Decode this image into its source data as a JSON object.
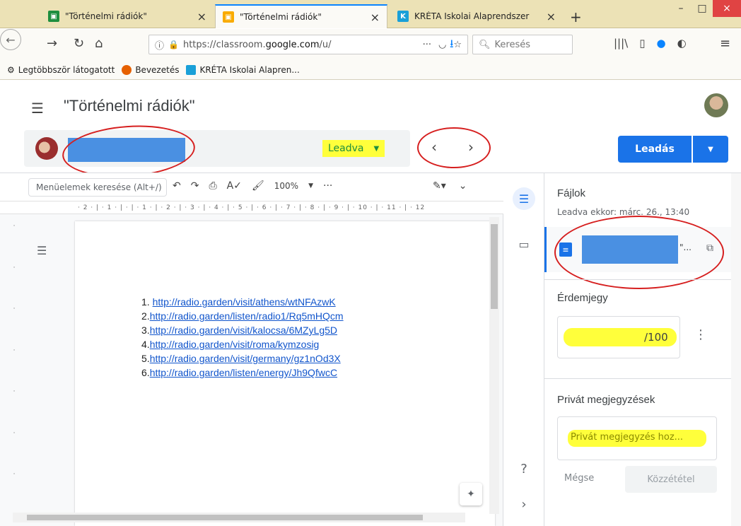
{
  "browser": {
    "tabs": [
      {
        "title": "\"Történelmi rádiók\"",
        "close": "×"
      },
      {
        "title": "\"Történelmi rádiók\"",
        "close": "×"
      },
      {
        "title": "KRÉTA Iskolai Alaprendszer",
        "close": "×"
      }
    ],
    "new_tab": "+",
    "window": {
      "minimize": "–",
      "maximize": "□",
      "close": "×"
    },
    "url_prefix": "https://classroom.",
    "url_domain": "google.com",
    "url_suffix": "/u/",
    "search_placeholder": "Keresés",
    "bookmarks": [
      {
        "label": "Legtöbbször látogatott"
      },
      {
        "label": "Bevezetés"
      },
      {
        "label": "KRÉTA Iskolai Alapren..."
      }
    ]
  },
  "classroom": {
    "title": "\"Történelmi rádiók\"",
    "status": "Leadva",
    "submit_label": "Leadás"
  },
  "docs": {
    "menu_search": "Menüelemek keresése (Alt+/)",
    "zoom": "100%",
    "ruler": "· 2 · | · 1 · |  · | · 1 · | · 2 · | · 3 · | · 4 · | · 5 · | · 6 · | · 7 · | · 8 · | · 9 · | · 10 · | · 11 · | · 12",
    "links": [
      {
        "num": "1. ",
        "url": "http://radio.garden/visit/athens/wtNFAzwK"
      },
      {
        "num": "2.",
        "url": "http://radio.garden/listen/radio1/Rq5mHQcm"
      },
      {
        "num": "3.",
        "url": "http://radio.garden/visit/kalocsa/6MZyLg5D"
      },
      {
        "num": "4.",
        "url": "http://radio.garden/visit/roma/kymzosig"
      },
      {
        "num": "5.",
        "url": "http://radio.garden/visit/germany/gz1nOd3X"
      },
      {
        "num": "6.",
        "url": "http://radio.garden/listen/energy/Jh9QfwcC"
      }
    ]
  },
  "panel": {
    "files_title": "Fájlok",
    "submitted_at": "Leadva ekkor: márc. 26., 13:40",
    "file_ellipsis": "\"...",
    "grade_title": "Érdemjegy",
    "grade_value": "/100",
    "private_title": "Privát megjegyzések",
    "private_placeholder": "Privát megjegyzés hoz...",
    "cancel_label": "Mégse",
    "publish_label": "Közzététel"
  },
  "colors": {
    "primary": "#1a73e8",
    "highlight": "#ffff3b",
    "annotation_red": "#d61f1f",
    "status_green": "#1e8e3e"
  }
}
